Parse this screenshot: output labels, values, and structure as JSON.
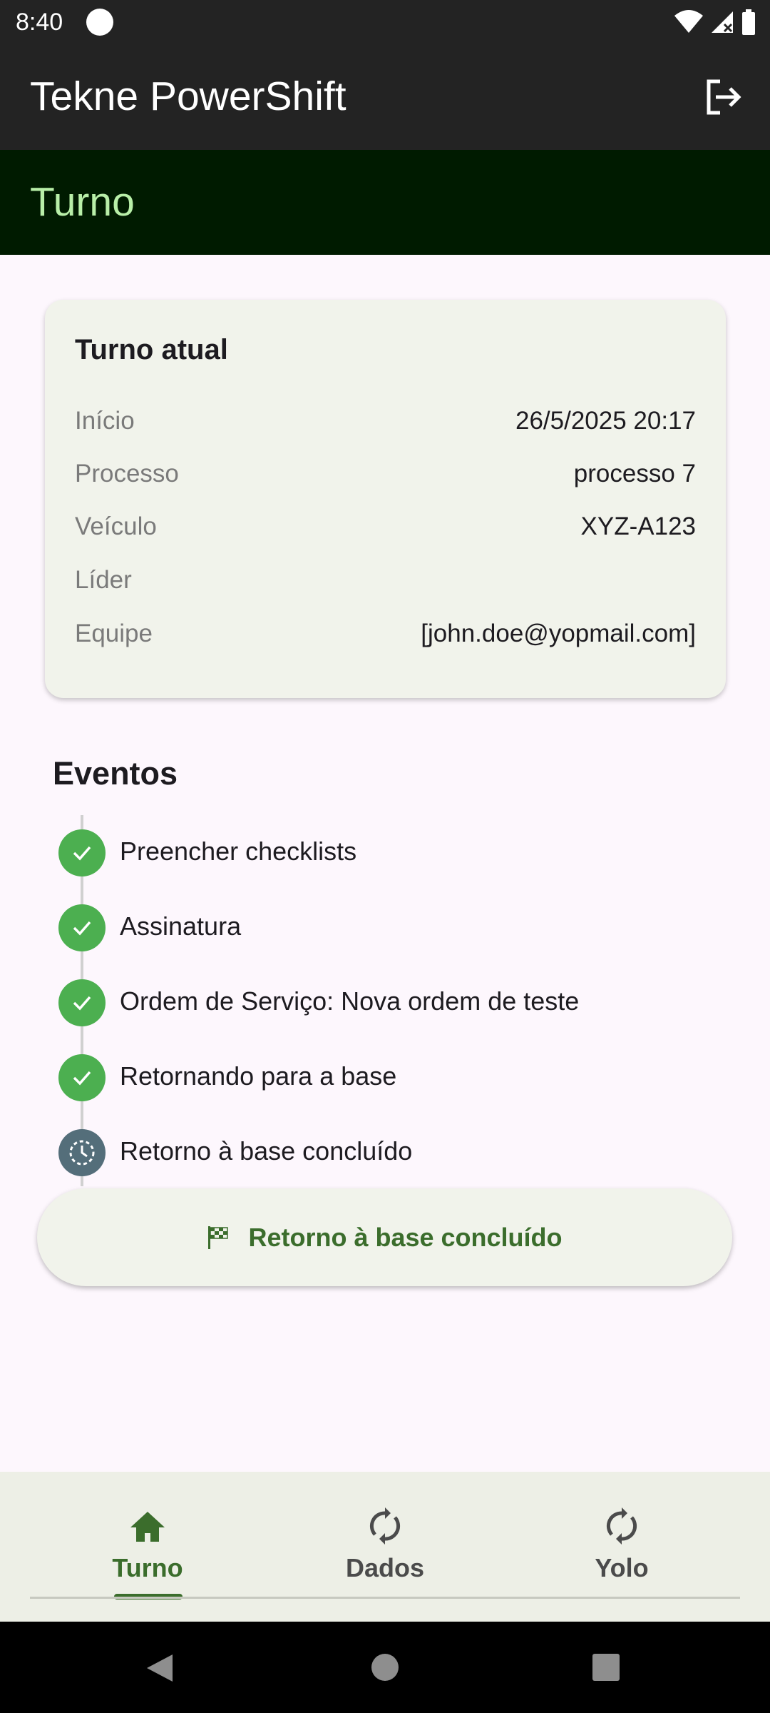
{
  "status_bar": {
    "time": "8:40"
  },
  "app_bar": {
    "title": "Tekne PowerShift",
    "logout_icon": "logout-icon"
  },
  "section": {
    "title": "Turno"
  },
  "current_shift": {
    "title": "Turno atual",
    "rows": [
      {
        "label": "Início",
        "value": "26/5/2025 20:17"
      },
      {
        "label": "Processo",
        "value": "processo 7"
      },
      {
        "label": "Veículo",
        "value": "XYZ-A123"
      },
      {
        "label": "Líder",
        "value": ""
      },
      {
        "label": "Equipe",
        "value": "[john.doe@yopmail.com]"
      }
    ]
  },
  "events": {
    "title": "Eventos",
    "items": [
      {
        "label": "Preencher checklists",
        "status": "done"
      },
      {
        "label": "Assinatura",
        "status": "done"
      },
      {
        "label": "Ordem de Serviço: Nova ordem de teste",
        "status": "done"
      },
      {
        "label": "Retornando para a base",
        "status": "done"
      },
      {
        "label": "Retorno à base concluído",
        "status": "pending"
      }
    ]
  },
  "action_button": {
    "label": "Retorno à base concluído",
    "icon": "checkered-flag-icon"
  },
  "bottom_nav": {
    "items": [
      {
        "label": "Turno",
        "icon": "home-icon",
        "active": true
      },
      {
        "label": "Dados",
        "icon": "sync-icon",
        "active": false
      },
      {
        "label": "Yolo",
        "icon": "sync-icon",
        "active": false
      }
    ]
  },
  "colors": {
    "app_bar": "#232323",
    "section_bar": "#001b00",
    "section_title": "#b8efa8",
    "accent": "#3b6d2c",
    "done": "#4caf50",
    "pending": "#546e7a"
  }
}
